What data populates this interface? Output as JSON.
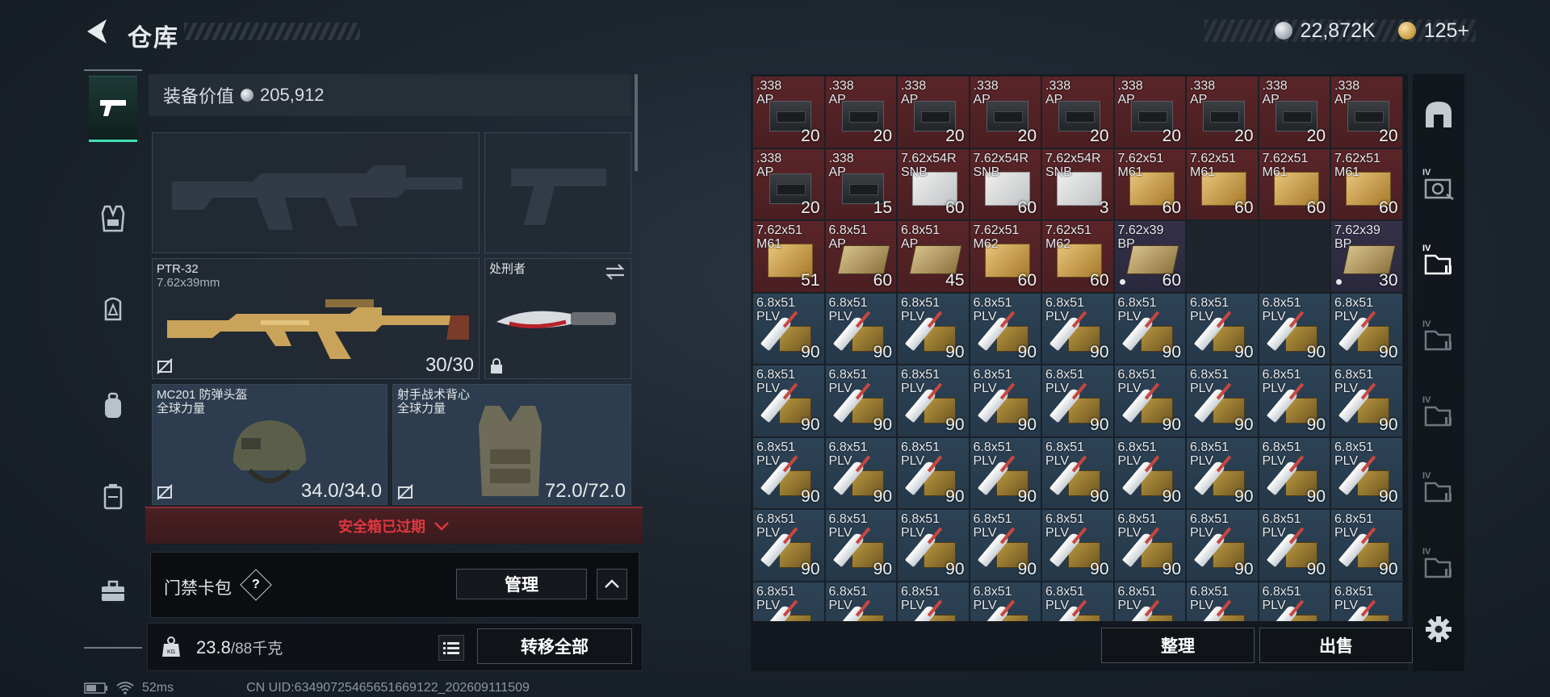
{
  "header": {
    "title": "仓库",
    "silver_amount": "22,872K",
    "gold_amount": "125+"
  },
  "nav": {
    "items": [
      "gun-icon",
      "vest-icon",
      "helmet-icon",
      "backpack-icon",
      "container-icon",
      "briefcase-icon"
    ],
    "active": 0
  },
  "equipment": {
    "value_label": "装备价值",
    "value": "205,912",
    "primary_weapon": {
      "name": "PTR-32",
      "caliber": "7.62x39mm",
      "ammo": "30/30"
    },
    "melee": {
      "name": "处刑者"
    },
    "helmet": {
      "name": "MC201 防弹头盔",
      "origin": "全球力量",
      "durability": "34.0/34.0"
    },
    "vest": {
      "name": "射手战术背心",
      "origin": "全球力量",
      "durability": "72.0/72.0"
    },
    "safe_box_status": "安全箱已过期",
    "keycard": {
      "label": "门禁卡包",
      "help": "?",
      "manage_label": "管理"
    },
    "weight": {
      "current": "23.8",
      "max": "/88千克"
    },
    "transfer_all_label": "转移全部"
  },
  "status": {
    "ping": "52ms",
    "uid": "CN UID:634907254656516691​22_202609111509"
  },
  "storage": {
    "items": [
      {
        "label": ".338\nAP",
        "count": "20",
        "color": "red",
        "art": "can"
      },
      {
        "label": ".338\nAP",
        "count": "20",
        "color": "red",
        "art": "can"
      },
      {
        "label": ".338\nAP",
        "count": "20",
        "color": "red",
        "art": "can"
      },
      {
        "label": ".338\nAP",
        "count": "20",
        "color": "red",
        "art": "can"
      },
      {
        "label": ".338\nAP",
        "count": "20",
        "color": "red",
        "art": "can"
      },
      {
        "label": ".338\nAP",
        "count": "20",
        "color": "red",
        "art": "can"
      },
      {
        "label": ".338\nAP",
        "count": "20",
        "color": "red",
        "art": "can"
      },
      {
        "label": ".338\nAP",
        "count": "20",
        "color": "red",
        "art": "can"
      },
      {
        "label": ".338\nAP",
        "count": "20",
        "color": "red",
        "art": "can"
      },
      {
        "label": ".338\nAP",
        "count": "20",
        "color": "red",
        "art": "can"
      },
      {
        "label": ".338\nAP",
        "count": "15",
        "color": "red",
        "art": "can"
      },
      {
        "label": "7.62x54R\nSNB",
        "count": "60",
        "color": "red",
        "art": "wbox"
      },
      {
        "label": "7.62x54R\nSNB",
        "count": "60",
        "color": "red",
        "art": "wbox"
      },
      {
        "label": "7.62x54R\nSNB",
        "count": "3",
        "color": "red",
        "art": "wbox"
      },
      {
        "label": "7.62x51\nM61",
        "count": "60",
        "color": "red",
        "art": "ybox"
      },
      {
        "label": "7.62x51\nM61",
        "count": "60",
        "color": "red",
        "art": "ybox"
      },
      {
        "label": "7.62x51\nM61",
        "count": "60",
        "color": "red",
        "art": "ybox"
      },
      {
        "label": "7.62x51\nM61",
        "count": "60",
        "color": "red",
        "art": "ybox"
      },
      {
        "label": "7.62x51\nM61",
        "count": "51",
        "color": "red",
        "art": "ybox"
      },
      {
        "label": "6.8x51\nAP",
        "count": "60",
        "color": "red",
        "art": "bbox"
      },
      {
        "label": "6.8x51\nAP",
        "count": "45",
        "color": "red",
        "art": "bbox"
      },
      {
        "label": "7.62x51\nM62",
        "count": "60",
        "color": "red",
        "art": "ybox"
      },
      {
        "label": "7.62x51\nM62",
        "count": "60",
        "color": "red",
        "art": "ybox"
      },
      {
        "label": "7.62x39\nBP",
        "count": "60",
        "color": "purple",
        "art": "bbox",
        "dot": true
      },
      {
        "label": "",
        "count": "",
        "color": "empty",
        "art": ""
      },
      {
        "label": "",
        "count": "",
        "color": "empty",
        "art": ""
      },
      {
        "label": "7.62x39\nBP",
        "count": "30",
        "color": "purple",
        "art": "bbox",
        "dot": true
      },
      {
        "label": "6.8x51\nPLV",
        "count": "90",
        "color": "blue",
        "art": "plp"
      },
      {
        "label": "6.8x51\nPLV",
        "count": "90",
        "color": "blue",
        "art": "plp"
      },
      {
        "label": "6.8x51\nPLV",
        "count": "90",
        "color": "blue",
        "art": "plp"
      },
      {
        "label": "6.8x51\nPLV",
        "count": "90",
        "color": "blue",
        "art": "plp"
      },
      {
        "label": "6.8x51\nPLV",
        "count": "90",
        "color": "blue",
        "art": "plp"
      },
      {
        "label": "6.8x51\nPLV",
        "count": "90",
        "color": "blue",
        "art": "plp"
      },
      {
        "label": "6.8x51\nPLV",
        "count": "90",
        "color": "blue",
        "art": "plp"
      },
      {
        "label": "6.8x51\nPLV",
        "count": "90",
        "color": "blue",
        "art": "plp"
      },
      {
        "label": "6.8x51\nPLV",
        "count": "90",
        "color": "blue",
        "art": "plp"
      },
      {
        "label": "6.8x51\nPLV",
        "count": "90",
        "color": "blue",
        "art": "plp"
      },
      {
        "label": "6.8x51\nPLV",
        "count": "90",
        "color": "blue",
        "art": "plp"
      },
      {
        "label": "6.8x51\nPLV",
        "count": "90",
        "color": "blue",
        "art": "plp"
      },
      {
        "label": "6.8x51\nPLV",
        "count": "90",
        "color": "blue",
        "art": "plp"
      },
      {
        "label": "6.8x51\nPLV",
        "count": "90",
        "color": "blue",
        "art": "plp"
      },
      {
        "label": "6.8x51\nPLV",
        "count": "90",
        "color": "blue",
        "art": "plp"
      },
      {
        "label": "6.8x51\nPLV",
        "count": "90",
        "color": "blue",
        "art": "plp"
      },
      {
        "label": "6.8x51\nPLV",
        "count": "90",
        "color": "blue",
        "art": "plp"
      },
      {
        "label": "6.8x51\nPLV",
        "count": "90",
        "color": "blue",
        "art": "plp"
      },
      {
        "label": "6.8x51\nPLV",
        "count": "90",
        "color": "blue",
        "art": "plp"
      },
      {
        "label": "6.8x51\nPLV",
        "count": "90",
        "color": "blue",
        "art": "plp"
      },
      {
        "label": "6.8x51\nPLV",
        "count": "90",
        "color": "blue",
        "art": "plp"
      },
      {
        "label": "6.8x51\nPLV",
        "count": "90",
        "color": "blue",
        "art": "plp"
      },
      {
        "label": "6.8x51\nPLV",
        "count": "90",
        "color": "blue",
        "art": "plp"
      },
      {
        "label": "6.8x51\nPLV",
        "count": "90",
        "color": "blue",
        "art": "plp"
      },
      {
        "label": "6.8x51\nPLV",
        "count": "90",
        "color": "blue",
        "art": "plp"
      },
      {
        "label": "6.8x51\nPLV",
        "count": "90",
        "color": "blue",
        "art": "plp"
      },
      {
        "label": "6.8x51\nPLV",
        "count": "90",
        "color": "blue",
        "art": "plp"
      },
      {
        "label": "6.8x51\nPLV",
        "count": "90",
        "color": "blue",
        "art": "plp"
      },
      {
        "label": "6.8x51\nPLV",
        "count": "90",
        "color": "blue",
        "art": "plp"
      },
      {
        "label": "6.8x51\nPLV",
        "count": "90",
        "color": "blue",
        "art": "plp"
      },
      {
        "label": "6.8x51\nPLV",
        "count": "90",
        "color": "blue",
        "art": "plp"
      },
      {
        "label": "6.8x51\nPLV",
        "count": "90",
        "color": "blue",
        "art": "plp"
      },
      {
        "label": "6.8x51\nPLV",
        "count": "90",
        "color": "blue",
        "art": "plp"
      },
      {
        "label": "6.8x51\nPLV",
        "count": "90",
        "color": "blue",
        "art": "plp"
      },
      {
        "label": "6.8x51\nPLV",
        "count": "90",
        "color": "blue",
        "art": "plp"
      },
      {
        "label": "6.8x51\nPLV",
        "count": "90",
        "color": "blue",
        "art": "plp"
      },
      {
        "label": "6.8x51\nPLV",
        "count": "",
        "color": "blue",
        "art": "plp"
      },
      {
        "label": "6.8x51\nPLV",
        "count": "",
        "color": "blue",
        "art": "plp"
      },
      {
        "label": "6.8x51\nPLV",
        "count": "",
        "color": "blue",
        "art": "plp"
      },
      {
        "label": "6.8x51\nPLV",
        "count": "",
        "color": "blue",
        "art": "plp"
      },
      {
        "label": "6.8x51\nPLV",
        "count": "",
        "color": "blue",
        "art": "plp"
      },
      {
        "label": "6.8x51\nPLV",
        "count": "",
        "color": "blue",
        "art": "plp"
      },
      {
        "label": "6.8x51\nPLV",
        "count": "",
        "color": "blue",
        "art": "plp"
      },
      {
        "label": "6.8x51\nPLV",
        "count": "",
        "color": "blue",
        "art": "plp"
      },
      {
        "label": "6.8x51\nPLV",
        "count": "",
        "color": "blue",
        "art": "plp"
      }
    ],
    "sort_label": "整理",
    "sell_label": "出售"
  },
  "right_sidebar": {
    "items": [
      "shelter-icon",
      "level-4-safe-icon",
      "level-4-folder-icon",
      "level-4-folder-icon",
      "level-4-folder-icon",
      "level-4-folder-icon",
      "level-4-folder-icon"
    ],
    "tier_label": "IV"
  },
  "colors": {
    "accent": "#3fe0b5",
    "warning": "#e0373f",
    "cell_red": "#4a1f22",
    "cell_blue": "#253849",
    "cell_purple": "#2a283c"
  }
}
